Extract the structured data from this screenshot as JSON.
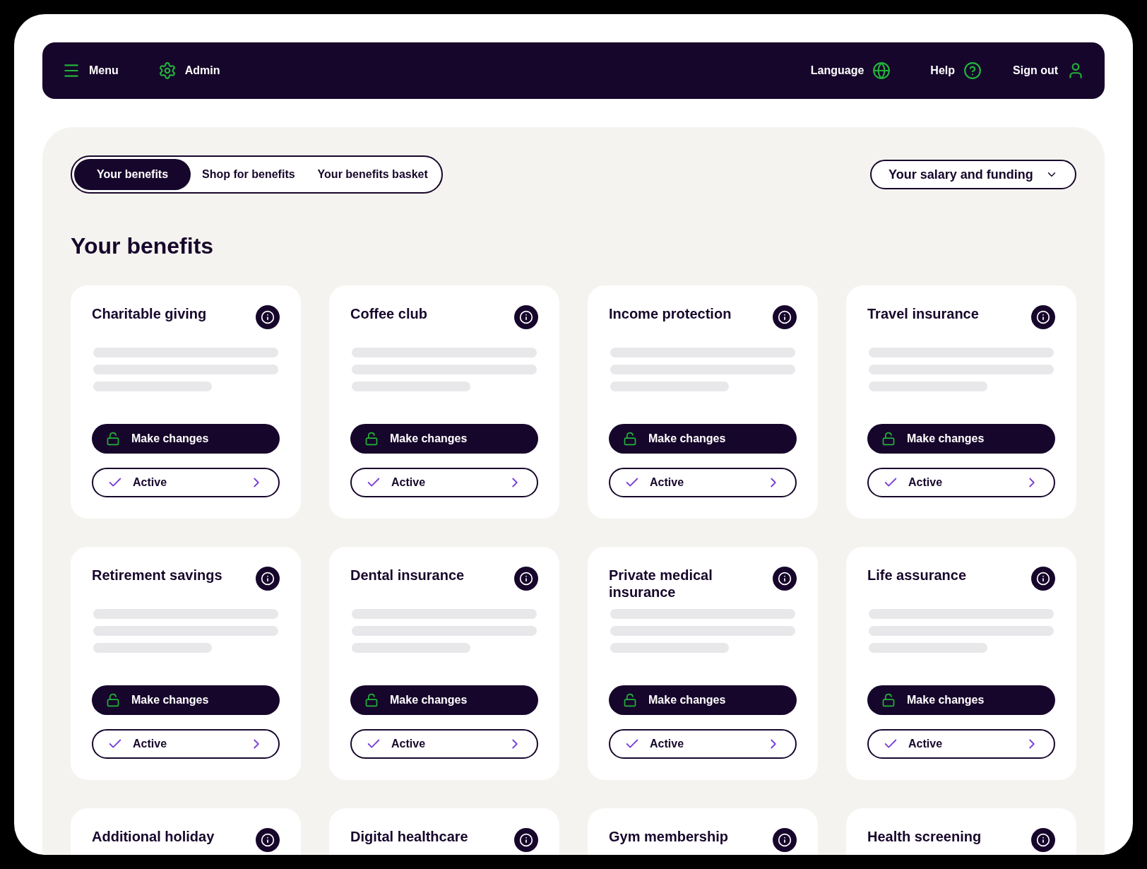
{
  "nav": {
    "menu": "Menu",
    "admin": "Admin",
    "language": "Language",
    "help": "Help",
    "sign_out": "Sign out"
  },
  "tabs": [
    {
      "label": "Your benefits",
      "selected": true
    },
    {
      "label": "Shop for benefits",
      "selected": false
    },
    {
      "label": "Your benefits basket",
      "selected": false
    }
  ],
  "funding_dropdown": "Your salary and funding",
  "heading": "Your benefits",
  "cards": [
    {
      "title": "Charitable giving",
      "action": "Make changes",
      "status": "Active"
    },
    {
      "title": "Coffee club",
      "action": "Make changes",
      "status": "Active"
    },
    {
      "title": "Income protection",
      "action": "Make changes",
      "status": "Active"
    },
    {
      "title": "Travel insurance",
      "action": "Make changes",
      "status": "Active"
    },
    {
      "title": "Retirement savings",
      "action": "Make changes",
      "status": "Active"
    },
    {
      "title": "Dental insurance",
      "action": "Make changes",
      "status": "Active"
    },
    {
      "title": "Private medical insurance",
      "action": "Make changes",
      "status": "Active"
    },
    {
      "title": "Life assurance",
      "action": "Make changes",
      "status": "Active"
    },
    {
      "title": "Additional holiday"
    },
    {
      "title": "Digital healthcare"
    },
    {
      "title": "Gym membership"
    },
    {
      "title": "Health screening"
    }
  ]
}
